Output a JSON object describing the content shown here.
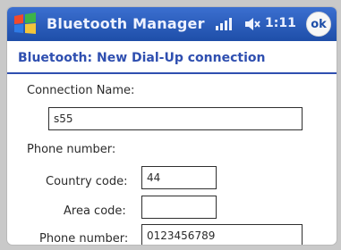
{
  "titlebar": {
    "app_title": "Bluetooth Manager",
    "clock": "1:11",
    "ok_label": "ok",
    "icons": [
      "windows-start-icon",
      "signal-icon",
      "speaker-icon"
    ]
  },
  "page": {
    "heading": "Bluetooth: New Dial-Up connection"
  },
  "form": {
    "connection_name_label": "Connection Name:",
    "connection_name_value": "s55",
    "phone_number_section_label": "Phone number:",
    "country_code_label": "Country code:",
    "country_code_value": "44",
    "area_code_label": "Area code:",
    "area_code_value": "",
    "phone_number_label": "Phone number:",
    "phone_number_value": "0123456789"
  },
  "colors": {
    "titlebar": "#2a5cc0",
    "heading_text": "#2f4fb0"
  }
}
